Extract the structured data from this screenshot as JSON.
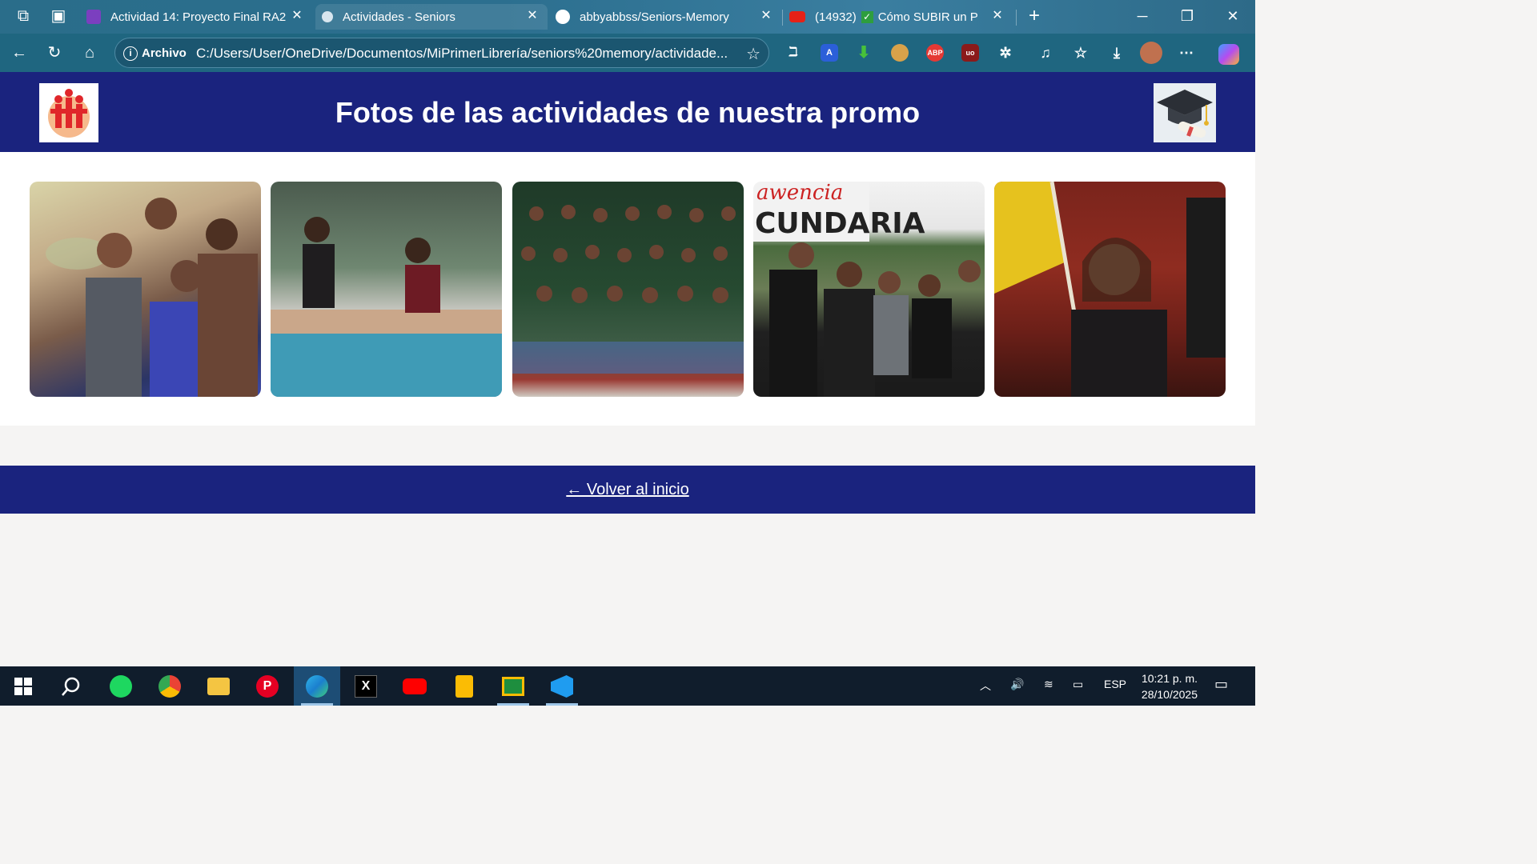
{
  "browser": {
    "tabs": [
      {
        "title": "Actividad 14: Proyecto Final RA2",
        "icon": "classroom-icon"
      },
      {
        "title": "Actividades - Seniors",
        "icon": "page-icon"
      },
      {
        "title": "abbyabbss/Seniors-Memory",
        "icon": "github-icon"
      },
      {
        "title_count": "(14932)",
        "title": "Cómo SUBIR un Proye",
        "icon": "youtube-icon"
      }
    ],
    "address_label": "Archivo",
    "url": "C:/Users/User/OneDrive/Documentos/MiPrimerLibrería/seniors%20memory/actividade..."
  },
  "page": {
    "title": "Fotos de las actividades de nuestra promo",
    "back_link": "← Volver al inicio"
  },
  "taskbar": {
    "language": "ESP",
    "time": "10:21 p. m.",
    "date": "28/10/2025"
  },
  "colors": {
    "header_bg": "#1a237e",
    "footer_bg": "#1a237e",
    "browser_accent": "#1f6680"
  }
}
